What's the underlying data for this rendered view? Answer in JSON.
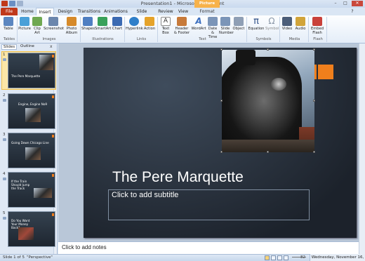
{
  "window": {
    "title": "Presentation1 - Microsoft PowerPoint",
    "contextual_tab": "Picture Tools",
    "minimize": "–",
    "maximize": "□",
    "close": "✕"
  },
  "tabs": [
    "File",
    "Home",
    "Insert",
    "Design",
    "Transitions",
    "Animations",
    "Slide Show",
    "Review",
    "View",
    "Format"
  ],
  "active_tab": "Insert",
  "ribbon": {
    "buttons": [
      {
        "label": "Table",
        "icon": "table-icon",
        "color": "#5b86c0"
      },
      {
        "label": "Picture",
        "icon": "picture-icon",
        "color": "#4aa0d8"
      },
      {
        "label": "Clip Art",
        "icon": "clip-art-icon",
        "color": "#6fa851"
      },
      {
        "label": "Screenshot",
        "icon": "screenshot-icon",
        "color": "#6c87ad"
      },
      {
        "label": "Photo Album",
        "icon": "photo-album-icon",
        "color": "#d68a2a"
      },
      {
        "label": "Shapes",
        "icon": "shapes-icon",
        "color": "#4f7fc2"
      },
      {
        "label": "SmartArt",
        "icon": "smartart-icon",
        "color": "#39a15a"
      },
      {
        "label": "Chart",
        "icon": "chart-icon",
        "color": "#3b6ab2"
      },
      {
        "label": "Hyperlink",
        "icon": "hyperlink-icon",
        "color": "#2f7fc9"
      },
      {
        "label": "Action",
        "icon": "action-icon",
        "color": "#e5a32a"
      },
      {
        "label": "Text Box",
        "icon": "text-box-icon",
        "color": "#8a8a8a"
      },
      {
        "label": "Header & Footer",
        "icon": "header-footer-icon",
        "color": "#c77a3a"
      },
      {
        "label": "WordArt",
        "icon": "wordart-icon",
        "color": "#3c6fbf"
      },
      {
        "label": "Date & Time",
        "icon": "date-time-icon",
        "color": "#7b95b8"
      },
      {
        "label": "Slide Number",
        "icon": "slide-number-icon",
        "color": "#7b95b8"
      },
      {
        "label": "Object",
        "icon": "object-icon",
        "color": "#8f9fb5"
      },
      {
        "label": "Equation",
        "icon": "equation-icon",
        "color": "#2d4f86"
      },
      {
        "label": "Symbol",
        "icon": "symbol-icon",
        "color": "#8b98a8"
      },
      {
        "label": "Video",
        "icon": "video-icon",
        "color": "#4b5d78"
      },
      {
        "label": "Audio",
        "icon": "audio-icon",
        "color": "#d1a43a"
      },
      {
        "label": "Embed Flash",
        "icon": "flash-icon",
        "color": "#c9413a"
      }
    ],
    "groups": [
      "Tables",
      "Images",
      "Illustrations",
      "Links",
      "Text",
      "Symbols",
      "Media",
      "Flash"
    ],
    "glyphs": {
      "equation": "π",
      "symbol": "Ω",
      "wordart": "A",
      "textbox": "A"
    }
  },
  "left_pane": {
    "tabs": [
      "Slides",
      "Outline"
    ],
    "close": "x",
    "slides": [
      {
        "number": "1",
        "title": "The Pere Marquette"
      },
      {
        "number": "2",
        "title": "Engine, Engine No9"
      },
      {
        "number": "3",
        "title": "Going Down Chicago Line"
      },
      {
        "number": "4",
        "title": "If the Train Should Jump the Track"
      },
      {
        "number": "5",
        "title": "Do You Want Your Money Back?"
      }
    ]
  },
  "slide": {
    "title": "The Pere Marquette",
    "subtitle_placeholder": "Click to add subtitle",
    "accent_color": "#f07f1c"
  },
  "notes": {
    "placeholder": "Click to add notes"
  },
  "status": {
    "slide_info": "Slide 1 of 5",
    "theme": "\"Perspective\"",
    "zoom": "82",
    "date": "Wednesday, November 16, 2011"
  }
}
